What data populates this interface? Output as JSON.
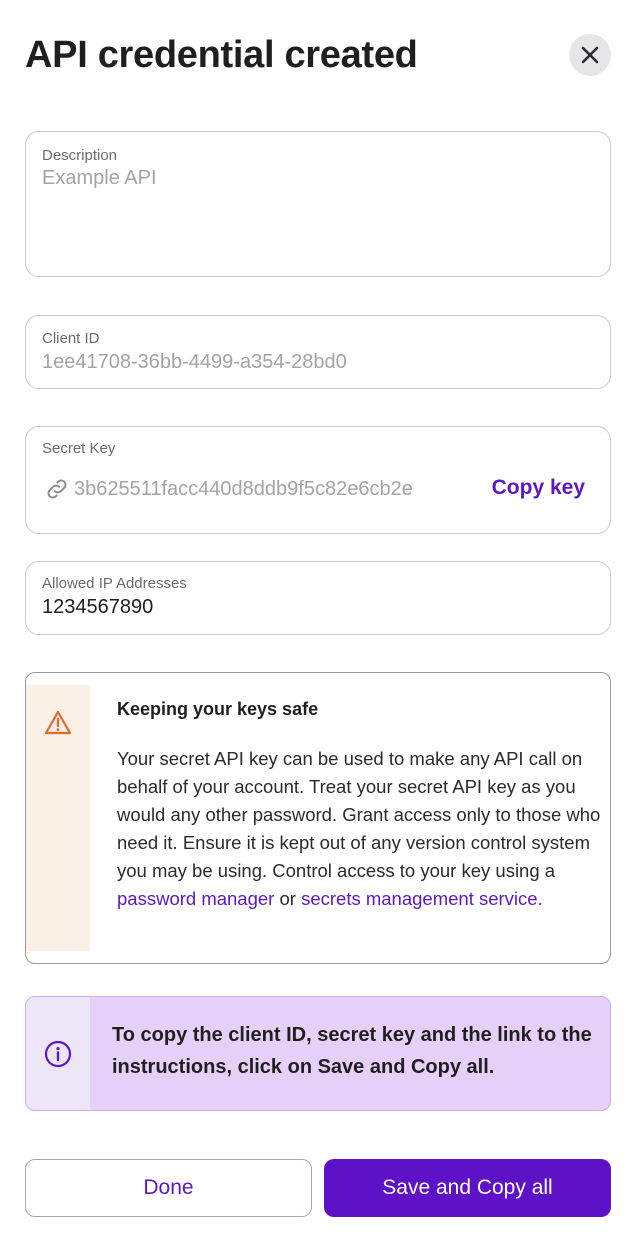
{
  "header": {
    "title": "API credential created",
    "close_icon": "close-icon"
  },
  "fields": {
    "description": {
      "label": "Description",
      "value": "Example API"
    },
    "client_id": {
      "label": "Client ID",
      "value": "1ee41708-36bb-4499-a354-28bd0"
    },
    "secret_key": {
      "label": "Secret Key",
      "value": "3b625511facc440d8ddb9f5c82e6cb2e",
      "icon": "link-icon",
      "copy_label": "Copy key"
    },
    "allowed_ip": {
      "label": "Allowed IP Addresses",
      "value": "1234567890"
    }
  },
  "warning": {
    "icon": "warning-icon",
    "title": "Keeping your keys safe",
    "body_text": "Your secret API key can be used to make any API call on behalf of your account. Treat your secret API key as you would any other password. Grant access only to those who need it. Ensure it is kept out of any version control system you may be using. Control access to your key using a",
    "link1": "password manager",
    "connector": "or",
    "link2": "secrets management service."
  },
  "info": {
    "icon": "info-icon",
    "text": "To copy the client ID, secret key and the link to the instructions, click on Save and Copy all."
  },
  "actions": {
    "done_label": "Done",
    "save_label": "Save and Copy all"
  },
  "colors": {
    "accent": "#5e17c4",
    "warning_icon": "#e06a2c",
    "info_bg": "#e6cff9"
  }
}
